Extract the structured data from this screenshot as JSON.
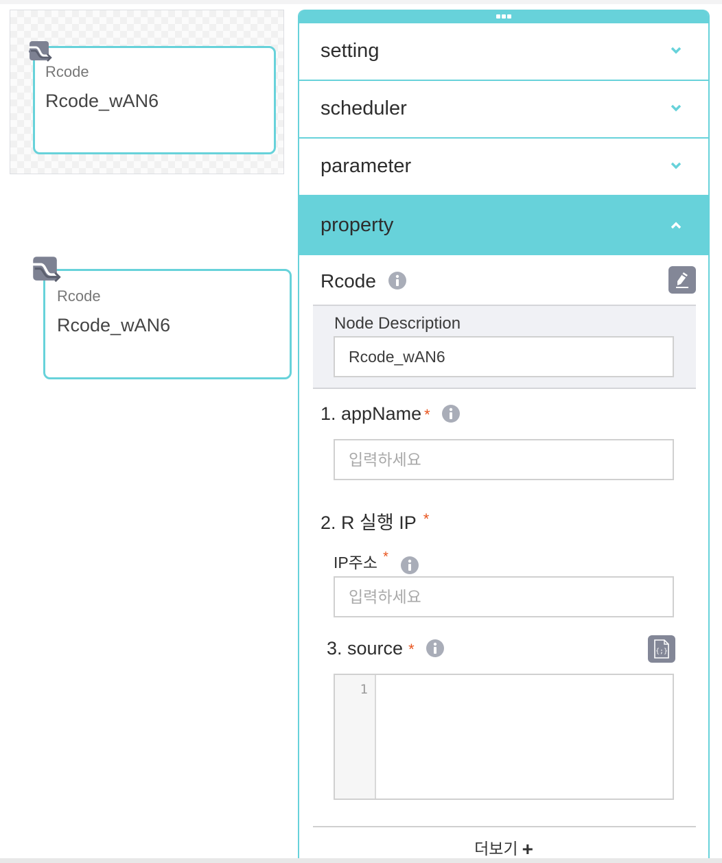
{
  "canvas": {
    "preview_node": {
      "type": "Rcode",
      "name": "Rcode_wAN6",
      "icon": "rcode-node-icon"
    },
    "node": {
      "type": "Rcode",
      "name": "Rcode_wAN6",
      "icon": "rcode-node-icon"
    }
  },
  "panel": {
    "handle_icon": "drag-handle-icon",
    "accent_color": "#67d2da",
    "sections": [
      {
        "label": "setting",
        "state": "collapsed",
        "icon": "chevron-down-icon"
      },
      {
        "label": "scheduler",
        "state": "collapsed",
        "icon": "chevron-down-icon"
      },
      {
        "label": "parameter",
        "state": "collapsed",
        "icon": "chevron-down-icon"
      },
      {
        "label": "property",
        "state": "expanded",
        "icon": "chevron-up-icon"
      }
    ],
    "property": {
      "title": "Rcode",
      "title_info_icon": "info-icon",
      "edit_icon": "pencil-icon",
      "node_description": {
        "label": "Node Description",
        "value": "Rcode_wAN6"
      },
      "fields": [
        {
          "label": "1. appName",
          "required": "*",
          "info_icon": "info-icon",
          "value": "",
          "placeholder": "입력하세요"
        },
        {
          "label": "2. R 실행 IP",
          "required": "*",
          "subfield": {
            "label": "IP주소",
            "required": "*",
            "info_icon": "info-icon",
            "value": "",
            "placeholder": "입력하세요"
          }
        },
        {
          "label": "3. source",
          "required": "*",
          "info_icon": "info-icon",
          "code_icon": "code-file-icon",
          "editor": {
            "line_numbers": [
              "1"
            ],
            "content": ""
          }
        }
      ],
      "more_label": "더보기",
      "more_icon": "+"
    }
  }
}
